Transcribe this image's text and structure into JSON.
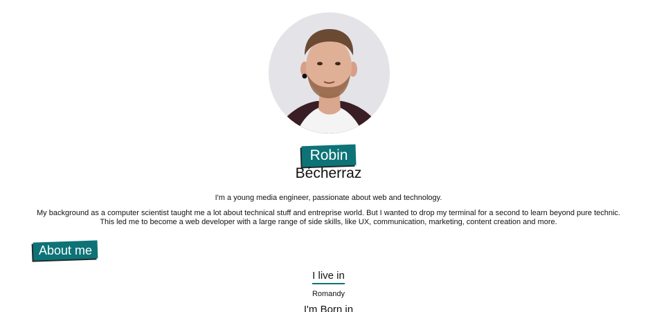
{
  "profile": {
    "first_name": "Robin",
    "last_name": "Bécherraz",
    "intro": "I'm a young media engineer, passionate about web and technology.",
    "bio": "My background as a computer scientist taught me a lot about technical stuff and entreprise world. But I wanted to drop my terminal for a second to learn beyond pure technic. This led me to become a web developer with a large range of side skills, like UX, communication, marketing, content creation and more.",
    "avatar": "profile-photo"
  },
  "about": {
    "title": "About me",
    "live_label": "I live in",
    "live_value": "Romandy",
    "born_label": "I'm Born in"
  },
  "colors": {
    "accent": "#0d7377",
    "text": "#111111",
    "background": "#ffffff"
  }
}
